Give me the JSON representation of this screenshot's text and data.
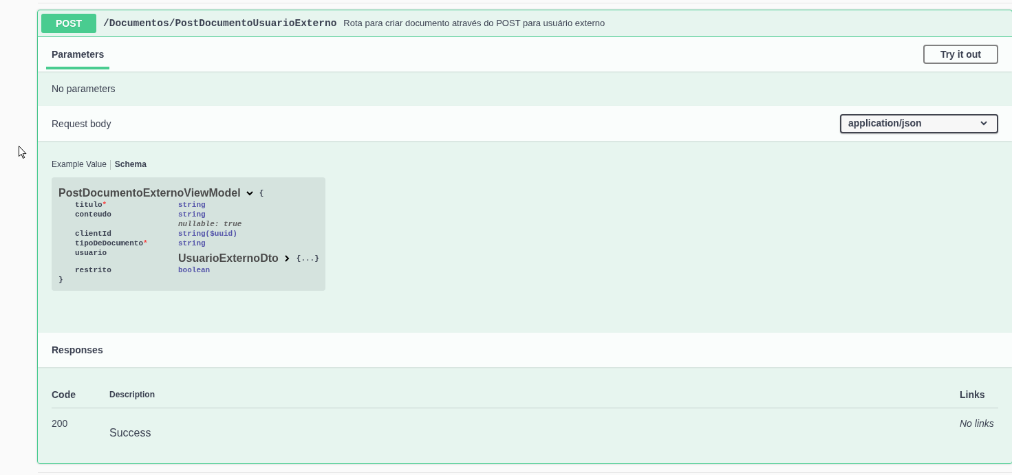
{
  "operation": {
    "method": "POST",
    "path": "/Documentos/PostDocumentoUsuarioExterno",
    "summary": "Rota para criar documento através do POST para usuário externo"
  },
  "parameters": {
    "tabs": [
      {
        "label": "Parameters",
        "selected": true
      }
    ],
    "try_button": "Try it out",
    "message": "No parameters"
  },
  "request_body": {
    "title": "Request body",
    "content_type": "application/json",
    "view_tabs": [
      {
        "label": "Example Value",
        "selected": false
      },
      {
        "label": "Schema",
        "selected": true
      }
    ],
    "model": {
      "name": "PostDocumentoExternoViewModel",
      "expanded": true,
      "open_brace": "{",
      "close_brace": "}",
      "properties": [
        {
          "name": "titulo",
          "required_mark": "*",
          "kind": "type",
          "type": "string"
        },
        {
          "name": "conteudo",
          "kind": "type",
          "type": "string",
          "note": "nullable: true"
        },
        {
          "name": "clientId",
          "kind": "type",
          "type": "string($uuid)"
        },
        {
          "name": "tipoDeDocumento",
          "required_mark": "*",
          "kind": "type",
          "type": "string"
        },
        {
          "name": "usuario",
          "kind": "model",
          "model": "UsuarioExternoDto",
          "expanded": false,
          "collapsed_text": "{...}"
        },
        {
          "name": "restrito",
          "kind": "type",
          "type": "boolean"
        }
      ]
    }
  },
  "responses": {
    "title": "Responses",
    "columns": [
      "Code",
      "Description",
      "Links"
    ],
    "rows": [
      {
        "code": "200",
        "description": "Success",
        "links": "No links"
      }
    ]
  }
}
